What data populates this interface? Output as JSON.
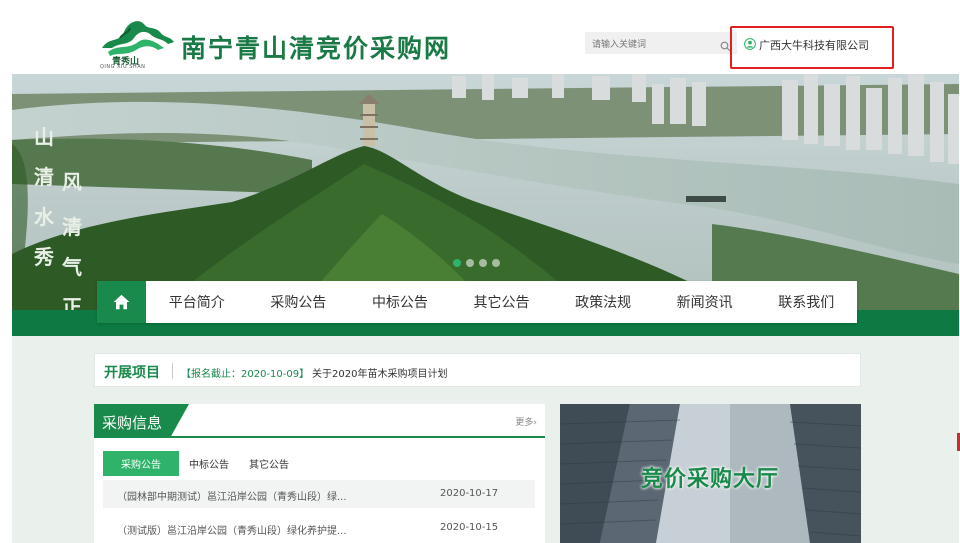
{
  "header": {
    "logo_text": "青秀山",
    "logo_en": "QING XIU SHAN",
    "site_title": "南宁青山清竞价采购网",
    "search_placeholder": "请输入关键词",
    "user_name": "广西大牛科技有限公司"
  },
  "banner": {
    "slide_count": 4,
    "active_slide": 1
  },
  "nav": {
    "items": [
      "平台简介",
      "采购公告",
      "中标公告",
      "其它公告",
      "政策法规",
      "新闻资讯",
      "联系我们"
    ]
  },
  "notice": {
    "title": "开展项目",
    "tag": "【报名截止：2020-10-09】",
    "text": "关于2020年苗木采购项目计划"
  },
  "procurement": {
    "title": "采购信息",
    "more": "更多",
    "tabs": [
      "采购公告",
      "中标公告",
      "其它公告"
    ],
    "rows": [
      {
        "title": "（园林部中期测试）邕江沿岸公园（青秀山段）绿...",
        "date": "2020-10-17"
      },
      {
        "title": "（测试版）邕江沿岸公园（青秀山段）绿化养护提...",
        "date": "2020-10-15"
      }
    ]
  },
  "hall": {
    "title": "竞价采购大厅"
  },
  "colors": {
    "brand_green": "#1a8a4c",
    "accent_green": "#2fb36b",
    "highlight_red": "#e02020"
  }
}
